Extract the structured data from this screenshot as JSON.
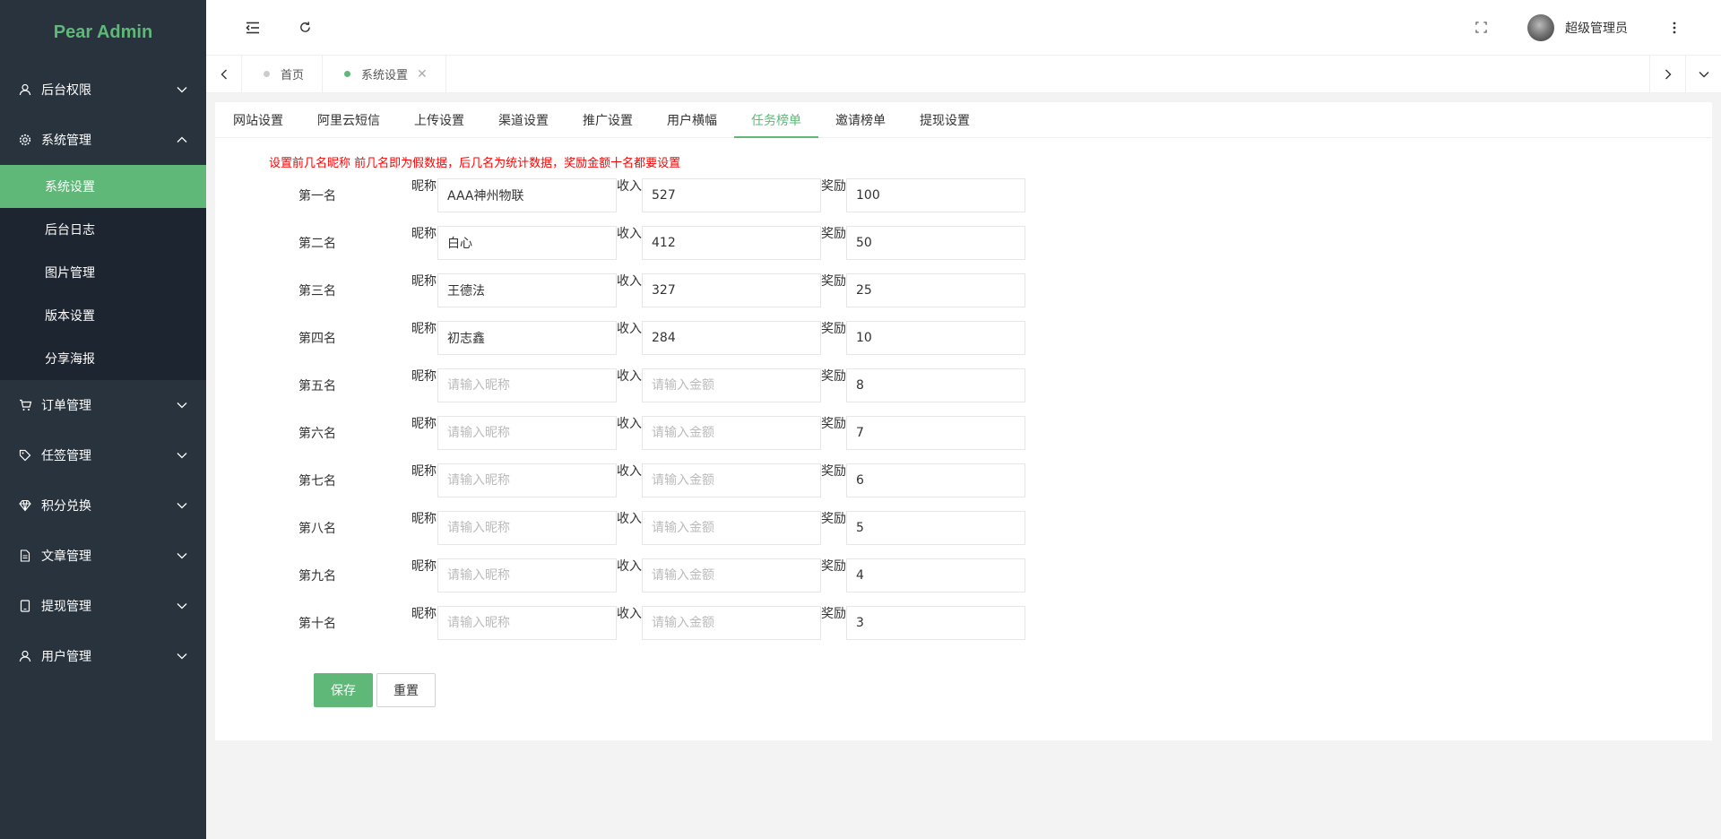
{
  "app": {
    "logo": "Pear Admin"
  },
  "sidebar": {
    "items": [
      {
        "label": "后台权限",
        "icon": "user-icon",
        "expanded": false
      },
      {
        "label": "系统管理",
        "icon": "gear-icon",
        "expanded": true,
        "children": [
          {
            "label": "系统设置",
            "active": true
          },
          {
            "label": "后台日志"
          },
          {
            "label": "图片管理"
          },
          {
            "label": "版本设置"
          },
          {
            "label": "分享海报"
          }
        ]
      },
      {
        "label": "订单管理",
        "icon": "cart-icon",
        "expanded": false
      },
      {
        "label": "任签管理",
        "icon": "tag-icon",
        "expanded": false
      },
      {
        "label": "积分兑换",
        "icon": "diamond-icon",
        "expanded": false
      },
      {
        "label": "文章管理",
        "icon": "document-icon",
        "expanded": false
      },
      {
        "label": "提现管理",
        "icon": "tablet-icon",
        "expanded": false
      },
      {
        "label": "用户管理",
        "icon": "user-icon",
        "expanded": false
      }
    ]
  },
  "header": {
    "user_name": "超级管理员"
  },
  "page_tabs": [
    {
      "label": "首页",
      "active": false,
      "closable": false
    },
    {
      "label": "系统设置",
      "active": true,
      "closable": true
    }
  ],
  "settings_tabs": [
    {
      "label": "网站设置"
    },
    {
      "label": "阿里云短信"
    },
    {
      "label": "上传设置"
    },
    {
      "label": "渠道设置"
    },
    {
      "label": "推广设置"
    },
    {
      "label": "用户横幅"
    },
    {
      "label": "任务榜单",
      "active": true
    },
    {
      "label": "邀请榜单"
    },
    {
      "label": "提现设置"
    }
  ],
  "form": {
    "notice": "设置前几名昵称 前几名即为假数据，后几名为统计数据，奖励金额十名都要设置",
    "nick_label": "昵称",
    "income_label": "收入",
    "reward_label": "奖励",
    "nick_placeholder": "请输入昵称",
    "income_placeholder": "请输入金额",
    "rows": [
      {
        "rank": "第一名",
        "nick": "AAA神州物联",
        "income": "527",
        "reward": "100"
      },
      {
        "rank": "第二名",
        "nick": "白心",
        "income": "412",
        "reward": "50"
      },
      {
        "rank": "第三名",
        "nick": "王德法",
        "income": "327",
        "reward": "25"
      },
      {
        "rank": "第四名",
        "nick": "初志鑫",
        "income": "284",
        "reward": "10"
      },
      {
        "rank": "第五名",
        "nick": "",
        "income": "",
        "reward": "8"
      },
      {
        "rank": "第六名",
        "nick": "",
        "income": "",
        "reward": "7"
      },
      {
        "rank": "第七名",
        "nick": "",
        "income": "",
        "reward": "6"
      },
      {
        "rank": "第八名",
        "nick": "",
        "income": "",
        "reward": "5"
      },
      {
        "rank": "第九名",
        "nick": "",
        "income": "",
        "reward": "4"
      },
      {
        "rank": "第十名",
        "nick": "",
        "income": "",
        "reward": "3"
      }
    ],
    "save_label": "保存",
    "reset_label": "重置"
  },
  "colors": {
    "accent": "#5fb878",
    "sidebar_bg": "#28333e",
    "submenu_bg": "#1d2530",
    "notice": "#ff0000"
  }
}
